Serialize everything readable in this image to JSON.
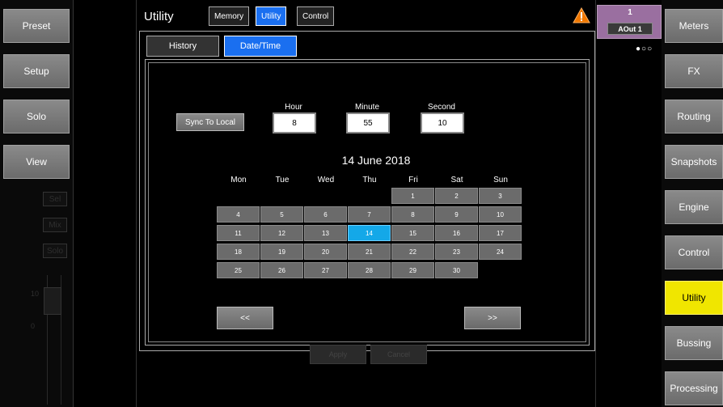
{
  "left_nav": [
    "Preset",
    "Setup",
    "Solo",
    "View"
  ],
  "right_nav": [
    "Meters",
    "FX",
    "Routing",
    "Snapshots",
    "Engine",
    "Control",
    "Utility",
    "Bussing",
    "Processing"
  ],
  "right_nav_active": "Utility",
  "strip_buttons": [
    "Sel",
    "Mix",
    "Solo"
  ],
  "fader_scale": [
    "10",
    "0"
  ],
  "header": {
    "title": "Utility",
    "tabs": [
      "Memory",
      "Utility",
      "Control"
    ],
    "active_tab": "Utility",
    "warning_icon": "warning-triangle-icon"
  },
  "channel": {
    "number": "1",
    "name": "AOut 1"
  },
  "page_indicator": "●○○",
  "sub_tabs": [
    "History",
    "Date/Time"
  ],
  "active_sub_tab": "Date/Time",
  "sync_label": "Sync To Local",
  "time": {
    "hour_label": "Hour",
    "hour_value": "8",
    "minute_label": "Minute",
    "minute_value": "55",
    "second_label": "Second",
    "second_value": "10"
  },
  "calendar": {
    "title": "14 June 2018",
    "weekdays": [
      "Mon",
      "Tue",
      "Wed",
      "Thu",
      "Fri",
      "Sat",
      "Sun"
    ],
    "first_weekday_index": 4,
    "days_in_month": 30,
    "selected_day": 14,
    "prev_label": "<<",
    "next_label": ">>"
  },
  "apply_label": "Apply",
  "cancel_label": "Cancel",
  "colors": {
    "active_tab": "#1a6ff0",
    "selected_day": "#14a8e8",
    "active_nav": "#f0e600",
    "channel_badge": "#9a6fa0",
    "warning": "#f07800"
  }
}
